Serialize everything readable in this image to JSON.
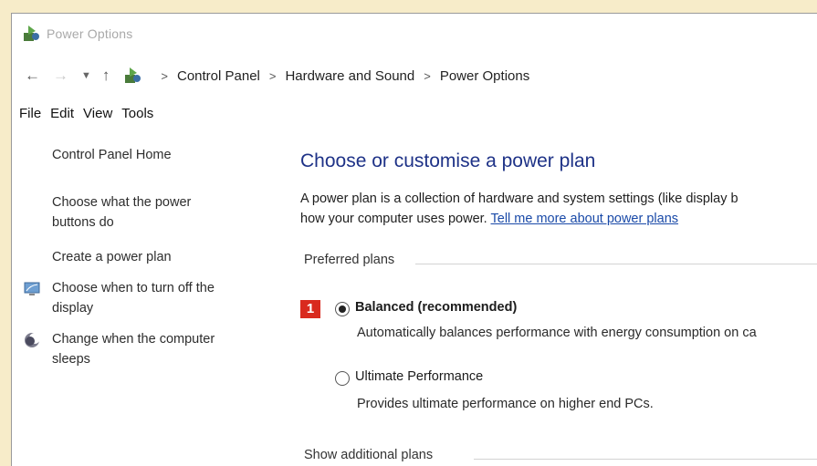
{
  "window": {
    "title": "Power Options"
  },
  "address": {
    "back_icon": "back-arrow-icon",
    "forward_icon": "forward-arrow-icon",
    "recent_icon": "chevron-down-icon",
    "up_icon": "up-arrow-icon",
    "crumbs": [
      "Control Panel",
      "Hardware and Sound",
      "Power Options"
    ],
    "separator": ">"
  },
  "menu": [
    "File",
    "Edit",
    "View",
    "Tools"
  ],
  "sidebar": {
    "home": "Control Panel Home",
    "items": [
      {
        "label_line1": "Choose what the power",
        "label_line2": "buttons do"
      },
      {
        "label_line1": "Create a power plan"
      },
      {
        "label_line1": "Choose when to turn off the",
        "label_line2": "display",
        "icon": "monitor-icon"
      },
      {
        "label_line1": "Change when the computer",
        "label_line2": "sleeps",
        "icon": "moon-icon"
      }
    ]
  },
  "main": {
    "heading": "Choose or customise a power plan",
    "desc_line1": "A power plan is a collection of hardware and system settings (like display b",
    "desc_line2_text": "how your computer uses power.",
    "desc_link": "Tell me more about power plans",
    "preferred_label": "Preferred plans",
    "badge": "1",
    "plans": [
      {
        "name": "Balanced (recommended)",
        "selected": true,
        "description": "Automatically balances performance with energy consumption on ca"
      },
      {
        "name": "Ultimate Performance",
        "selected": false,
        "description": "Provides ultimate performance on higher end PCs."
      }
    ],
    "show_additional": "Show additional plans"
  },
  "colors": {
    "background": "#f7ecc9",
    "heading": "#1e3287",
    "link": "#1a4aa8",
    "badge": "#d92a1e"
  }
}
